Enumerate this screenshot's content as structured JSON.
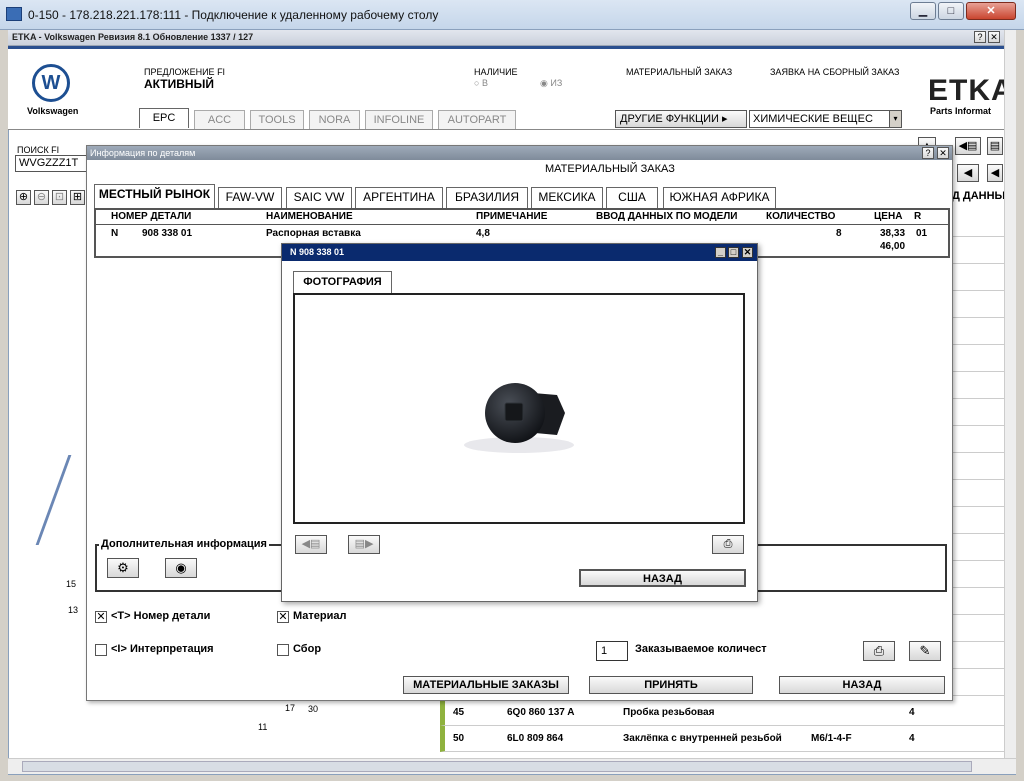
{
  "window": {
    "title": "0-150 - 178.218.221.178:111 - Подключение к удаленному рабочему столу",
    "min": "▁",
    "max": "□",
    "close": "✕"
  },
  "etka": {
    "title": "ETKA - Volkswagen Ревизия 8.1 Обновление 1337 / 127",
    "help": "?",
    "brand": "Volkswagen",
    "logo_text": "ETKA",
    "logo_sub": "Parts Informat",
    "offer_label": "ПРЕДЛОЖЕНИЕ FI",
    "offer_value": "АКТИВНЫЙ",
    "avail_label": "НАЛИЧИЕ",
    "avail_opt1": "В",
    "avail_opt2": "ИЗ",
    "mat_order_label": "МАТЕРИАЛЬНЫЙ ЗАКАЗ",
    "assembly_order_label": "ЗАЯВКА НА СБОРНЫЙ ЗАКАЗ",
    "tabs": [
      "EPC",
      "ACC",
      "TOOLS",
      "NORA",
      "INFOLINE",
      "AUTOPART"
    ],
    "other_functions": "ДРУГИЕ ФУНКЦИИ",
    "chem_select": "ХИМИЧЕСКИЕ ВЕЩЕС",
    "search_label": "ПОИСК FI",
    "search_value": "WVGZZZ1T",
    "right_col_header": "Д ДАННЫ"
  },
  "bg_list": [
    {
      "pos": "45",
      "part": "6Q0 860 137 A",
      "name": "Пробка резьбовая",
      "note": "",
      "qty": "4"
    },
    {
      "pos": "50",
      "part": "6L0 809 864",
      "name": "Заклёпка с внутренней резьбой",
      "note": "M6/1-4-F",
      "qty": "4"
    }
  ],
  "bg_labels": [
    "15",
    "13",
    "11",
    "17",
    "30"
  ],
  "dialog": {
    "title": "Информация по деталям",
    "help": "?",
    "close": "✕",
    "heading": "МАТЕРИАЛЬНЫЙ ЗАКАЗ",
    "tabs": [
      "МЕСТНЫЙ РЫНОК",
      "FAW-VW",
      "SAIC VW",
      "АРГЕНТИНА",
      "БРАЗИЛИЯ",
      "МЕКСИКА",
      "США",
      "ЮЖНАЯ АФРИКА"
    ],
    "columns": [
      "НОМЕР ДЕТАЛИ",
      "НАИМЕНОВАНИЕ",
      "ПРИМЕЧАНИЕ",
      "ВВОД ДАННЫХ ПО МОДЕЛИ",
      "КОЛИЧЕСТВО",
      "ЦЕНА",
      "R"
    ],
    "row": {
      "prefix": "N",
      "part": "908 338 01",
      "name": "Распорная вставка",
      "note": "4,8",
      "model": "",
      "qty": "8",
      "price": "38,33",
      "price2": "46,00",
      "r": "01"
    },
    "extra_info": "Дополнительная информация",
    "chk_part": "<T> Номер детали",
    "chk_interp": "<I> Интерпретация",
    "chk_material": "Материал",
    "chk_assembly": "Сбор",
    "order_qty_value": "1",
    "order_qty_label": "Заказываемое количест",
    "btn_mat_orders": "МАТЕРИАЛЬНЫЕ ЗАКАЗЫ",
    "btn_accept": "ПРИНЯТЬ",
    "btn_back": "НАЗАД"
  },
  "photo": {
    "title": "N  908 338 01",
    "tab": "ФОТОГРАФИЯ",
    "btn_back": "НАЗАД"
  }
}
